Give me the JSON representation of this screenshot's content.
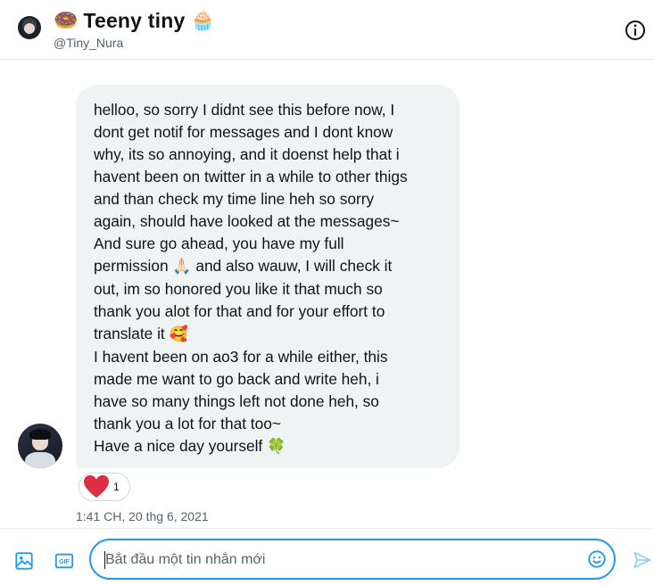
{
  "header": {
    "title": "Teeny tiny",
    "title_prefix_emoji": "🍩",
    "title_suffix_emoji": "🧁",
    "handle": "@Tiny_Nura"
  },
  "message": {
    "text_parts": [
      "helloo, so sorry I didnt see this before now, I\ndont get notif for messages and I dont know\nwhy, its so annoying, and it doenst help that i\nhavent been on twitter in a while to other thigs\nand than check my time line heh so sorry\nagain, should have looked at the messages~\nAnd sure go ahead, you have my full\npermission ",
      "🙏🏻",
      " and also wauw, I will check it\nout, im so honored you like it that much so\nthank you alot for that and for your effort to\ntranslate it ",
      "🥰",
      "\nI havent been on ao3 for a while either, this\nmade me want to go back and write heh, i\nhave so many things left not done heh, so\nthank you a lot for that too~\nHave a nice day yourself ",
      "🍀"
    ],
    "reaction": {
      "icon": "heart-icon",
      "count": "1"
    },
    "timestamp": "1:41 CH, 20 thg 6, 2021"
  },
  "composer": {
    "placeholder": "Bắt đầu một tin nhắn mới",
    "value": "",
    "gif_label": "GIF"
  },
  "colors": {
    "accent": "#1d9bf0",
    "bubble_bg": "#eff3f4",
    "secondary_text": "#536471",
    "heart": "#e0245e"
  }
}
